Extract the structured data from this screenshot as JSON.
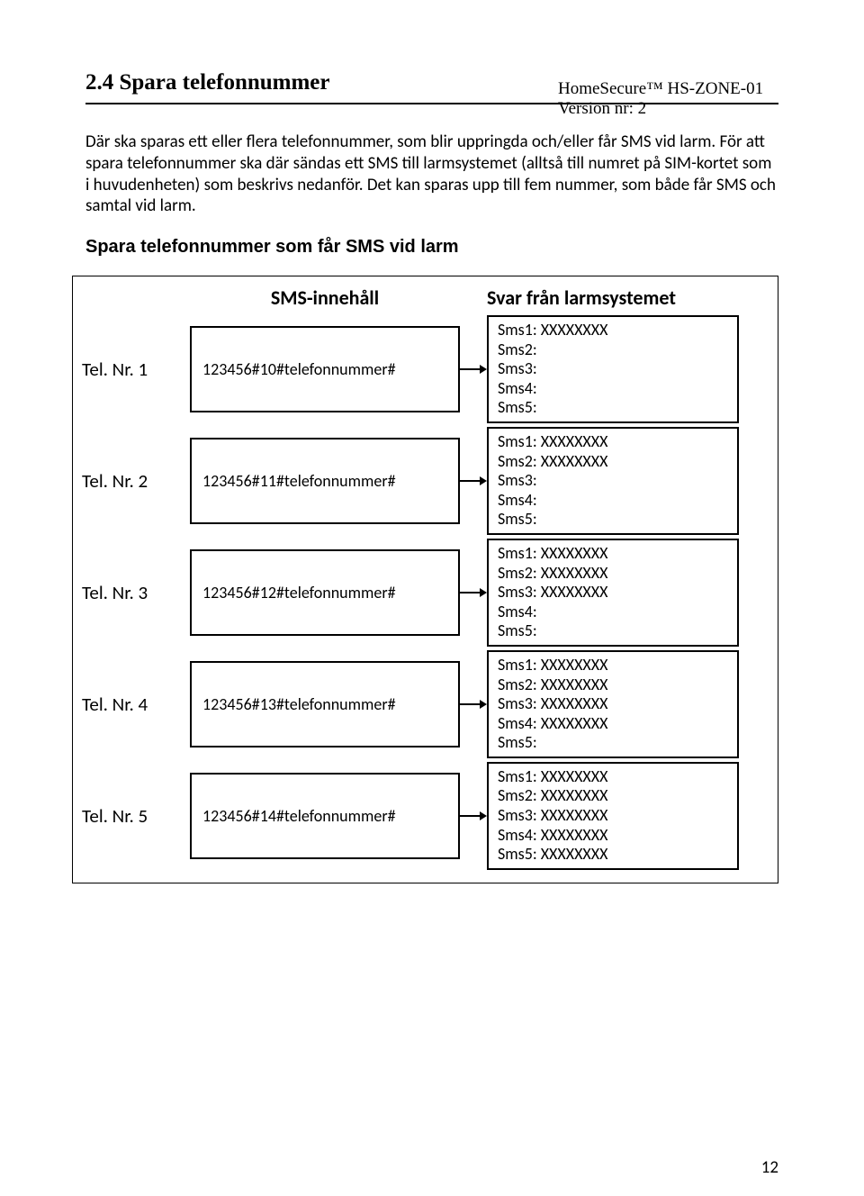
{
  "header": {
    "product": "HomeSecure™ HS-ZONE-01",
    "version": "Version nr: 2"
  },
  "section_title": "2.4 Spara telefonnummer",
  "paragraph": "Där ska sparas ett eller flera telefonnummer, som blir uppringda och/eller får SMS vid larm. För att spara telefonnummer ska där sändas ett SMS till larmsystemet (alltså till numret på SIM-kortet som i huvudenheten) som beskrivs nedanför. Det kan sparas upp till fem nummer, som både får SMS och samtal vid larm.",
  "sub_title": "Spara telefonnummer som får SMS vid larm",
  "diagram": {
    "head_sms": "SMS-innehåll",
    "head_resp": "Svar från larmsystemet",
    "rows": [
      {
        "label": "Tel. Nr. 1",
        "sms": "123456#10#telefonnummer#",
        "resp": [
          "Sms1: XXXXXXXX",
          "Sms2:",
          "Sms3:",
          "Sms4:",
          "Sms5:"
        ]
      },
      {
        "label": "Tel. Nr. 2",
        "sms": "123456#11#telefonnummer#",
        "resp": [
          "Sms1: XXXXXXXX",
          "Sms2: XXXXXXXX",
          "Sms3:",
          "Sms4:",
          "Sms5:"
        ]
      },
      {
        "label": "Tel. Nr. 3",
        "sms": "123456#12#telefonnummer#",
        "resp": [
          "Sms1: XXXXXXXX",
          "Sms2: XXXXXXXX",
          "Sms3: XXXXXXXX",
          "Sms4:",
          "Sms5:"
        ]
      },
      {
        "label": "Tel. Nr. 4",
        "sms": "123456#13#telefonnummer#",
        "resp": [
          "Sms1: XXXXXXXX",
          "Sms2: XXXXXXXX",
          "Sms3: XXXXXXXX",
          "Sms4: XXXXXXXX",
          "Sms5:"
        ]
      },
      {
        "label": "Tel. Nr. 5",
        "sms": "123456#14#telefonnummer#",
        "resp": [
          "Sms1: XXXXXXXX",
          "Sms2: XXXXXXXX",
          "Sms3: XXXXXXXX",
          "Sms4: XXXXXXXX",
          "Sms5: XXXXXXXX"
        ]
      }
    ]
  },
  "page_number": "12"
}
